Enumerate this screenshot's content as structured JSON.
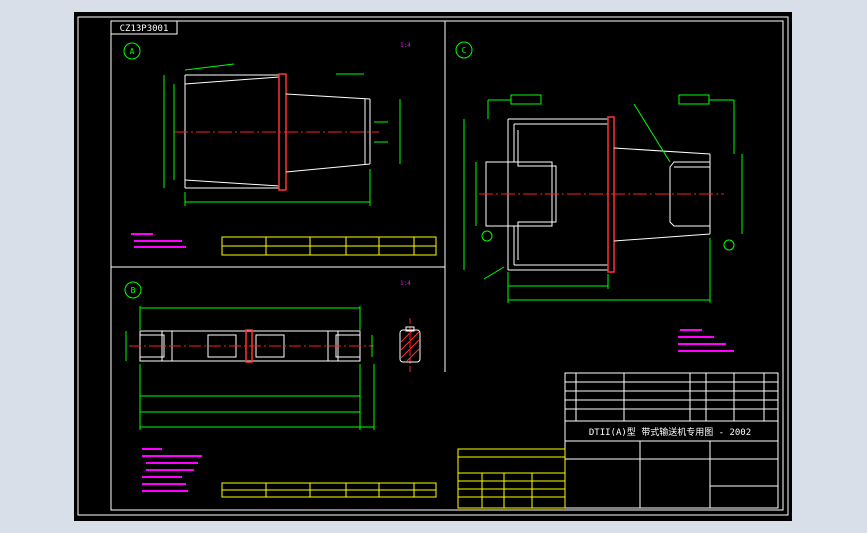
{
  "drawing": {
    "doc_code": "CZ13P3001",
    "title_block_main": "DTII(A)型  带式输送机专用图 - 2002"
  },
  "views": {
    "a": {
      "label": "A",
      "scale_note": "1:4"
    },
    "b": {
      "label": "B",
      "scale_note": "1:4"
    },
    "c": {
      "label": "C",
      "scale_note": ""
    }
  },
  "colors": {
    "background": "#000000",
    "frame": "#ffffff",
    "geometry": "#ffffff",
    "dimension": "#00ff00",
    "centerline": "#ff2020",
    "text": "#ff00ff",
    "table": "#ffff00",
    "flange": "#ff3333"
  }
}
